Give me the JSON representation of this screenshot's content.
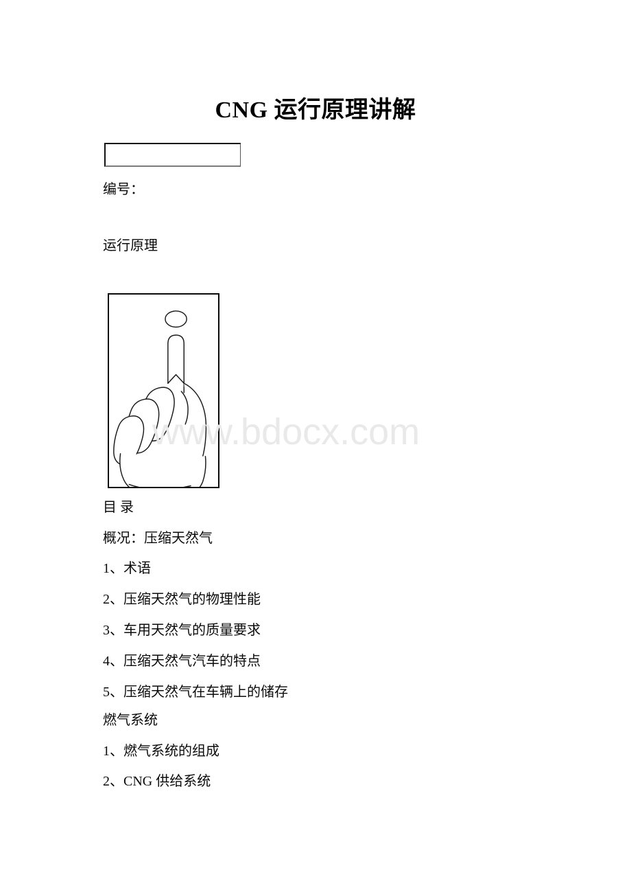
{
  "document": {
    "title": "CNG 运行原理讲解",
    "form_box_value": "",
    "number_label": "编号：",
    "section_heading": "运行原理",
    "watermark": "www.bdocx.com",
    "figure": {
      "name": "pointing-hand-illustration",
      "caption": ""
    },
    "toc": {
      "heading": "目 录",
      "overview": "概况：压缩天然气",
      "items": [
        "1、术语",
        "2、压缩天然气的物理性能",
        "3、车用天然气的质量要求",
        "4、压缩天然气汽车的特点",
        "5、压缩天然气在车辆上的储存"
      ],
      "section2_heading": "燃气系统",
      "section2_items": [
        "1、燃气系统的组成",
        "2、CNG 供给系统"
      ]
    }
  },
  "colors": {
    "text": "#0b0b0b",
    "border": "#0a0a0a",
    "watermark": "#e9e9e9",
    "page_background": "#ffffff"
  }
}
